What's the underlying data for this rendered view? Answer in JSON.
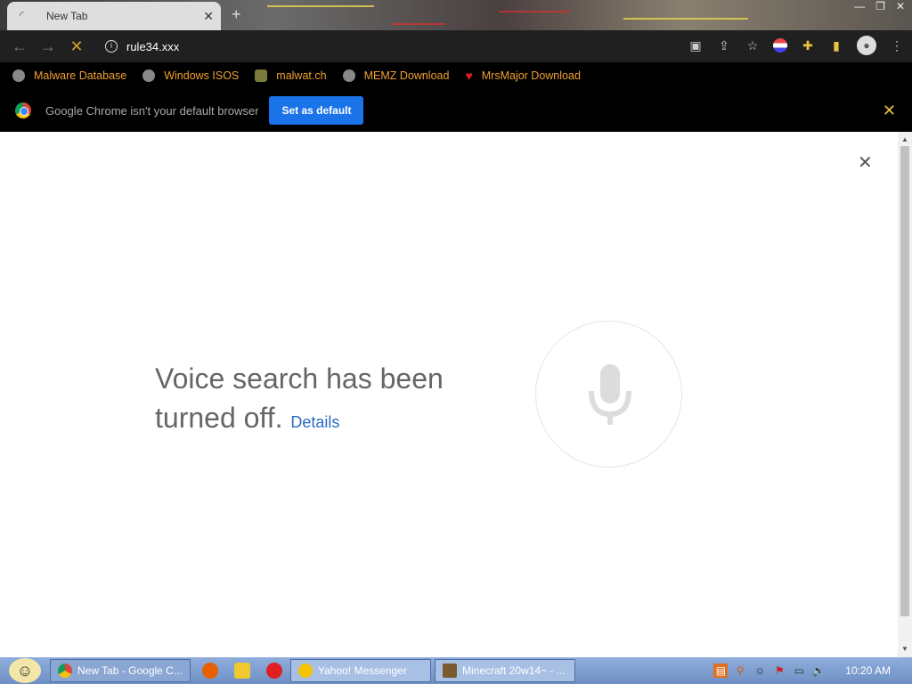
{
  "tab": {
    "title": "New Tab",
    "close": "✕"
  },
  "newtab_symbol": "+",
  "window_controls": [
    "—",
    "❐",
    "✕"
  ],
  "toolbar": {
    "back": "←",
    "forward": "→",
    "stop": "✕",
    "url": "rule34.xxx",
    "info": "i"
  },
  "toolbar_icons": [
    "cast-icon",
    "share-icon",
    "star-icon",
    "flag-icon",
    "puzzle-icon",
    "sidebar-icon",
    "profile-icon",
    "menu-icon"
  ],
  "bookmarks": [
    {
      "label": "Malware Database",
      "icon": "globe-icon"
    },
    {
      "label": "Windows ISOS",
      "icon": "globe-icon"
    },
    {
      "label": "malwat.ch",
      "icon": "malwatch-icon"
    },
    {
      "label": "MEMZ Download",
      "icon": "globe-icon"
    },
    {
      "label": "MrsMajor Download",
      "icon": "heart-icon"
    }
  ],
  "infobar": {
    "text": "Google Chrome isn't your default browser",
    "button": "Set as default",
    "close": "✕"
  },
  "voice": {
    "line1": "Voice search has been",
    "line2": "turned off.",
    "details": "Details",
    "close": "✕"
  },
  "taskbar": {
    "buttons": [
      {
        "label": "New Tab - Google C...",
        "icon": "chrome-icon",
        "active": true
      },
      {
        "label": "Yahoo! Messenger",
        "icon": "yahoo-icon"
      },
      {
        "label": "Minecraft 20w14~ - ...",
        "icon": "minecraft-icon"
      }
    ],
    "clock": "10:20 AM"
  },
  "colors": {
    "bookmark_text": "#f0a030",
    "accent_blue": "#1a73e8",
    "details_link": "#2a6bc4"
  }
}
